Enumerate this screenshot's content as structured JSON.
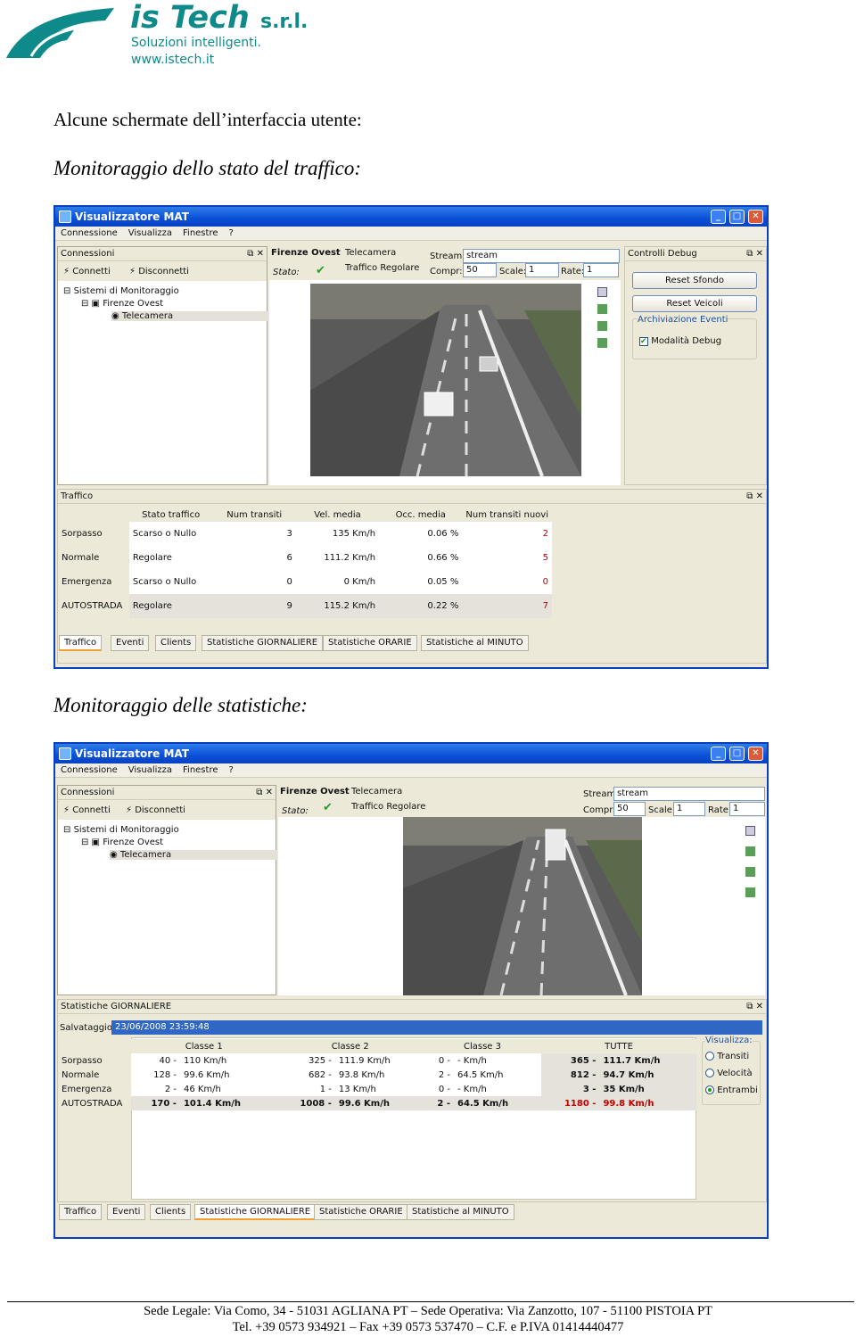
{
  "header": {
    "brand_main": "is Tech",
    "brand_suffix": "s.r.l.",
    "tagline": "Soluzioni intelligenti.",
    "website": "www.istech.it",
    "brand_color": "#0f8a8a"
  },
  "intro": "Alcune schermate dell’interfaccia utente:",
  "section1": "Monitoraggio dello stato del traffico:",
  "section2": "Monitoraggio delle statistiche:",
  "window": {
    "title": "Visualizzatore MAT",
    "menu": [
      "Connessione",
      "Visualizza",
      "Finestre",
      "?"
    ]
  },
  "connections": {
    "title": "Connessioni",
    "connect": "Connetti",
    "disconnect": "Disconnetti",
    "tree_root": "Sistemi di Monitoraggio",
    "tree_site": "Firenze Ovest",
    "tree_cam": "Telecamera"
  },
  "camera_header": {
    "site": "Firenze Ovest",
    "device": "Telecamera",
    "stato_label": "Stato:",
    "stato_value": "Traffico Regolare",
    "stream_label": "Stream:",
    "stream_value": "stream",
    "compr_label": "Compr:",
    "compr_value": "50",
    "scale_label": "Scale:",
    "scale_value": "1",
    "rate_label": "Rate:",
    "rate_value": "1"
  },
  "debug": {
    "title": "Controlli Debug",
    "reset_bg": "Reset Sfondo",
    "reset_veh": "Reset Veicoli",
    "archive": "Archiviazione Eventi",
    "debug_mode": "Modalità Debug"
  },
  "traffic": {
    "title": "Traffico",
    "columns": [
      "Stato traffico",
      "Num transiti",
      "Vel. media",
      "Occ. media",
      "Num transiti nuovi"
    ],
    "rows": [
      {
        "name": "Sorpasso",
        "stato": "Scarso o Nullo",
        "transiti": "3",
        "vel": "135 Km/h",
        "occ": "0.06 %",
        "nuovi": "2"
      },
      {
        "name": "Normale",
        "stato": "Regolare",
        "transiti": "6",
        "vel": "111.2 Km/h",
        "occ": "0.66 %",
        "nuovi": "5"
      },
      {
        "name": "Emergenza",
        "stato": "Scarso o Nullo",
        "transiti": "0",
        "vel": "0 Km/h",
        "occ": "0.05 %",
        "nuovi": "0"
      },
      {
        "name": "AUTOSTRADA",
        "stato": "Regolare",
        "transiti": "9",
        "vel": "115.2 Km/h",
        "occ": "0.22 %",
        "nuovi": "7"
      }
    ]
  },
  "tabs1": [
    "Traffico",
    "Eventi",
    "Clients",
    "Statistiche GIORNALIERE",
    "Statistiche ORARIE",
    "Statistiche al MINUTO"
  ],
  "stats": {
    "title": "Statistiche GIORNALIERE",
    "save_label": "Salvataggio:",
    "save_value": "23/06/2008 23:59:48",
    "columns": [
      "Classe 1",
      "Classe 2",
      "Classe 3",
      "TUTTE"
    ],
    "rows": [
      {
        "name": "Sorpasso",
        "c1n": "40 -",
        "c1v": "110 Km/h",
        "c2n": "325 -",
        "c2v": "111.9 Km/h",
        "c3n": "0 -",
        "c3v": "- Km/h",
        "tn": "365 -",
        "tv": "111.7 Km/h"
      },
      {
        "name": "Normale",
        "c1n": "128 -",
        "c1v": "99.6 Km/h",
        "c2n": "682 -",
        "c2v": "93.8 Km/h",
        "c3n": "2 -",
        "c3v": "64.5 Km/h",
        "tn": "812 -",
        "tv": "94.7 Km/h"
      },
      {
        "name": "Emergenza",
        "c1n": "2 -",
        "c1v": "46 Km/h",
        "c2n": "1 -",
        "c2v": "13 Km/h",
        "c3n": "0 -",
        "c3v": "- Km/h",
        "tn": "3 -",
        "tv": "35 Km/h"
      },
      {
        "name": "AUTOSTRADA",
        "c1n": "170 -",
        "c1v": "101.4 Km/h",
        "c2n": "1008 -",
        "c2v": "99.6 Km/h",
        "c3n": "2 -",
        "c3v": "64.5 Km/h",
        "tn": "1180 -",
        "tv": "99.8 Km/h"
      }
    ],
    "view_title": "Visualizza:",
    "view_options": [
      "Transiti",
      "Velocità",
      "Entrambi"
    ],
    "view_selected": "Entrambi"
  },
  "tabs2": [
    "Traffico",
    "Eventi",
    "Clients",
    "Statistiche GIORNALIERE",
    "Statistiche ORARIE",
    "Statistiche al MINUTO"
  ],
  "footer": {
    "line1": "Sede Legale: Via Como, 34 - 51031 AGLIANA PT – Sede Operativa: Via Zanzotto, 107 - 51100 PISTOIA PT",
    "line2": "Tel. +39 0573 934921 – Fax +39 0573 537470 – C.F. e P.IVA 01414440477"
  }
}
